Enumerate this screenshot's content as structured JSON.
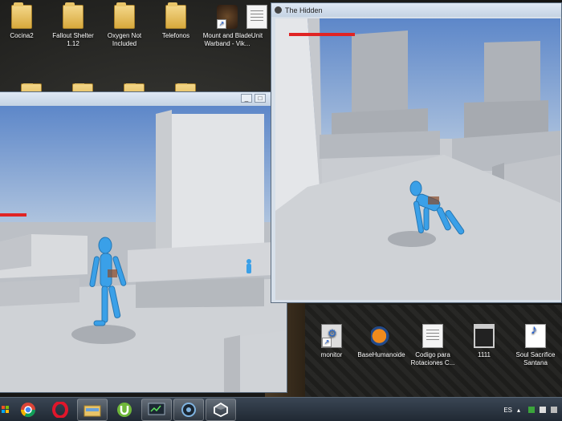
{
  "desktop": {
    "icons_top": [
      {
        "label": "Cocina2",
        "icon": "folder-icon"
      },
      {
        "label": "Fallout Shelter 1.12",
        "icon": "folder-icon"
      },
      {
        "label": "Oxygen Not Included",
        "icon": "folder-icon"
      },
      {
        "label": "Telefonos",
        "icon": "folder-icon"
      },
      {
        "label": "Mount and Blade Warband - Vik...",
        "icon": "game-shortcut-icon"
      },
      {
        "label": "Unit",
        "icon": "unity-icon"
      }
    ],
    "icons_bottom": [
      {
        "label": "monitor",
        "icon": "monitor-shortcut-icon"
      },
      {
        "label": "BaseHumanoide",
        "icon": "blender-icon"
      },
      {
        "label": "Codigo para Rotaciones C...",
        "icon": "document-icon"
      },
      {
        "label": "1111",
        "icon": "console-icon"
      },
      {
        "label": "Soul Sacrifice Santana",
        "icon": "mp3-icon"
      }
    ]
  },
  "window_left": {
    "title": "",
    "health_color": "#e02424"
  },
  "window_right": {
    "title": "The Hidden",
    "health_color": "#e02424"
  },
  "taskbar": {
    "apps": [
      {
        "name": "windows-start-icon",
        "open": false
      },
      {
        "name": "chrome-icon",
        "open": false
      },
      {
        "name": "opera-icon",
        "open": false
      },
      {
        "name": "file-explorer-icon",
        "open": true
      },
      {
        "name": "utorrent-icon",
        "open": false
      },
      {
        "name": "monitor-app-icon",
        "open": true
      },
      {
        "name": "app-circle-icon",
        "open": true
      },
      {
        "name": "unity-icon",
        "open": true
      }
    ],
    "language": "ES"
  },
  "colors": {
    "sky_top": "#5d87c9",
    "sky_bottom": "#b6c9e0",
    "floor": "#c9ccd1",
    "humanoid": "#3aa0e8"
  }
}
